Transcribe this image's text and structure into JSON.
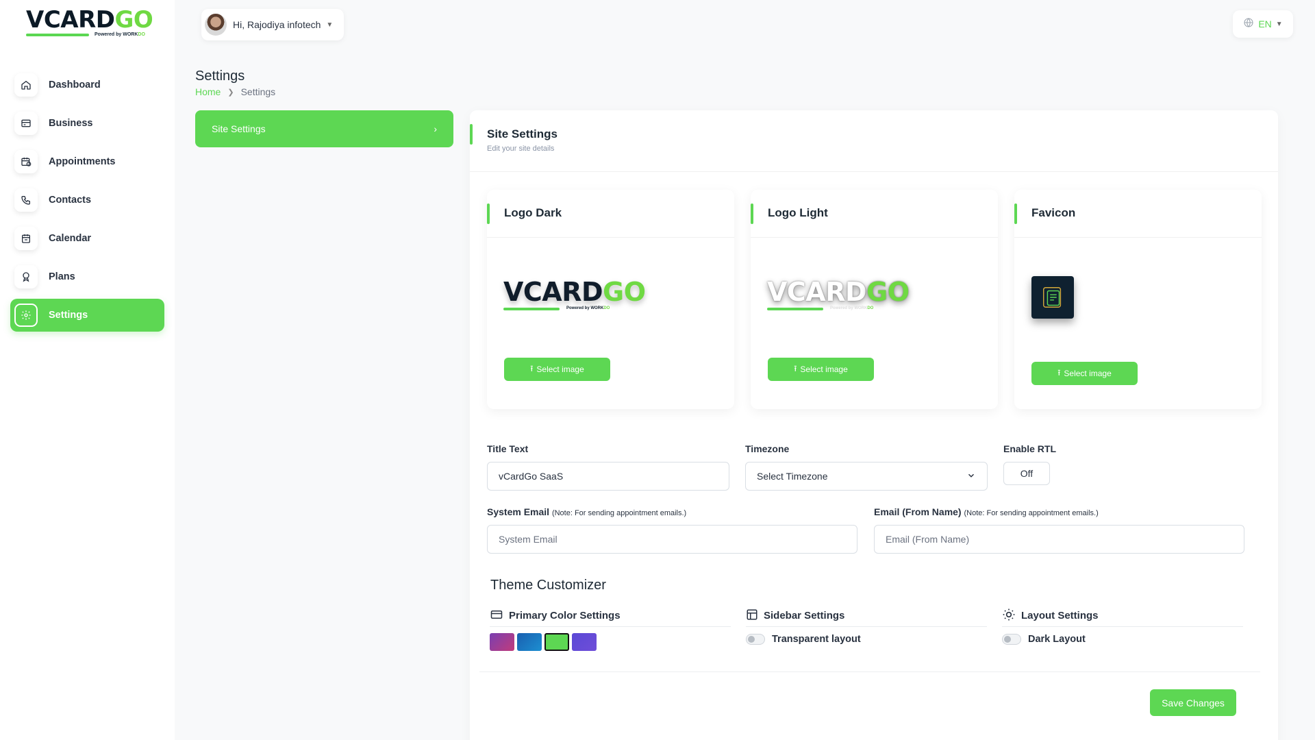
{
  "brand": {
    "wordmark_a": "VCARD",
    "wordmark_b": "GO",
    "powered": "Powered by ",
    "powered_brand": "WORK",
    "powered_brand_b": "DO",
    "colors": {
      "green": "#5dd753",
      "dark": "#0c1a26"
    }
  },
  "sidebar": {
    "items": [
      {
        "label": "Dashboard",
        "icon": "home-icon"
      },
      {
        "label": "Business",
        "icon": "business-card-icon"
      },
      {
        "label": "Appointments",
        "icon": "calendar-clock-icon"
      },
      {
        "label": "Contacts",
        "icon": "phone-icon"
      },
      {
        "label": "Calendar",
        "icon": "calendar-icon"
      },
      {
        "label": "Plans",
        "icon": "award-icon"
      },
      {
        "label": "Settings",
        "icon": "gear-icon",
        "active": true
      }
    ]
  },
  "header": {
    "greeting": "Hi, Rajodiya infotech",
    "language": "EN"
  },
  "page": {
    "title": "Settings",
    "breadcrumb_home": "Home",
    "breadcrumb_current": "Settings"
  },
  "settings_menu": {
    "item": "Site Settings"
  },
  "site_settings": {
    "title": "Site Settings",
    "subtitle": "Edit your site details",
    "logo_dark": {
      "title": "Logo Dark",
      "button": "Select image"
    },
    "logo_light": {
      "title": "Logo Light",
      "button": "Select image"
    },
    "favicon": {
      "title": "Favicon",
      "button": "Select image"
    },
    "title_text": {
      "label": "Title Text",
      "value": "vCardGo SaaS"
    },
    "timezone": {
      "label": "Timezone",
      "value": "Select Timezone"
    },
    "rtl": {
      "label": "Enable RTL",
      "value": "Off"
    },
    "system_email": {
      "label": "System Email",
      "note": "(Note: For sending appointment emails.)",
      "placeholder": "System Email"
    },
    "email_from_name": {
      "label": "Email (From Name)",
      "note": "(Note: For sending appointment emails.)",
      "placeholder": "Email (From Name)"
    }
  },
  "theme": {
    "title": "Theme Customizer",
    "primary": {
      "title": "Primary Color Settings",
      "swatches": [
        "#c13c7c",
        "#1c8fd1",
        "#5dd753",
        "#6f4ed8"
      ],
      "selected_index": 2
    },
    "sidebar": {
      "title": "Sidebar Settings",
      "toggle": "Transparent layout"
    },
    "layout": {
      "title": "Layout Settings",
      "toggle": "Dark Layout"
    }
  },
  "actions": {
    "save": "Save Changes"
  }
}
